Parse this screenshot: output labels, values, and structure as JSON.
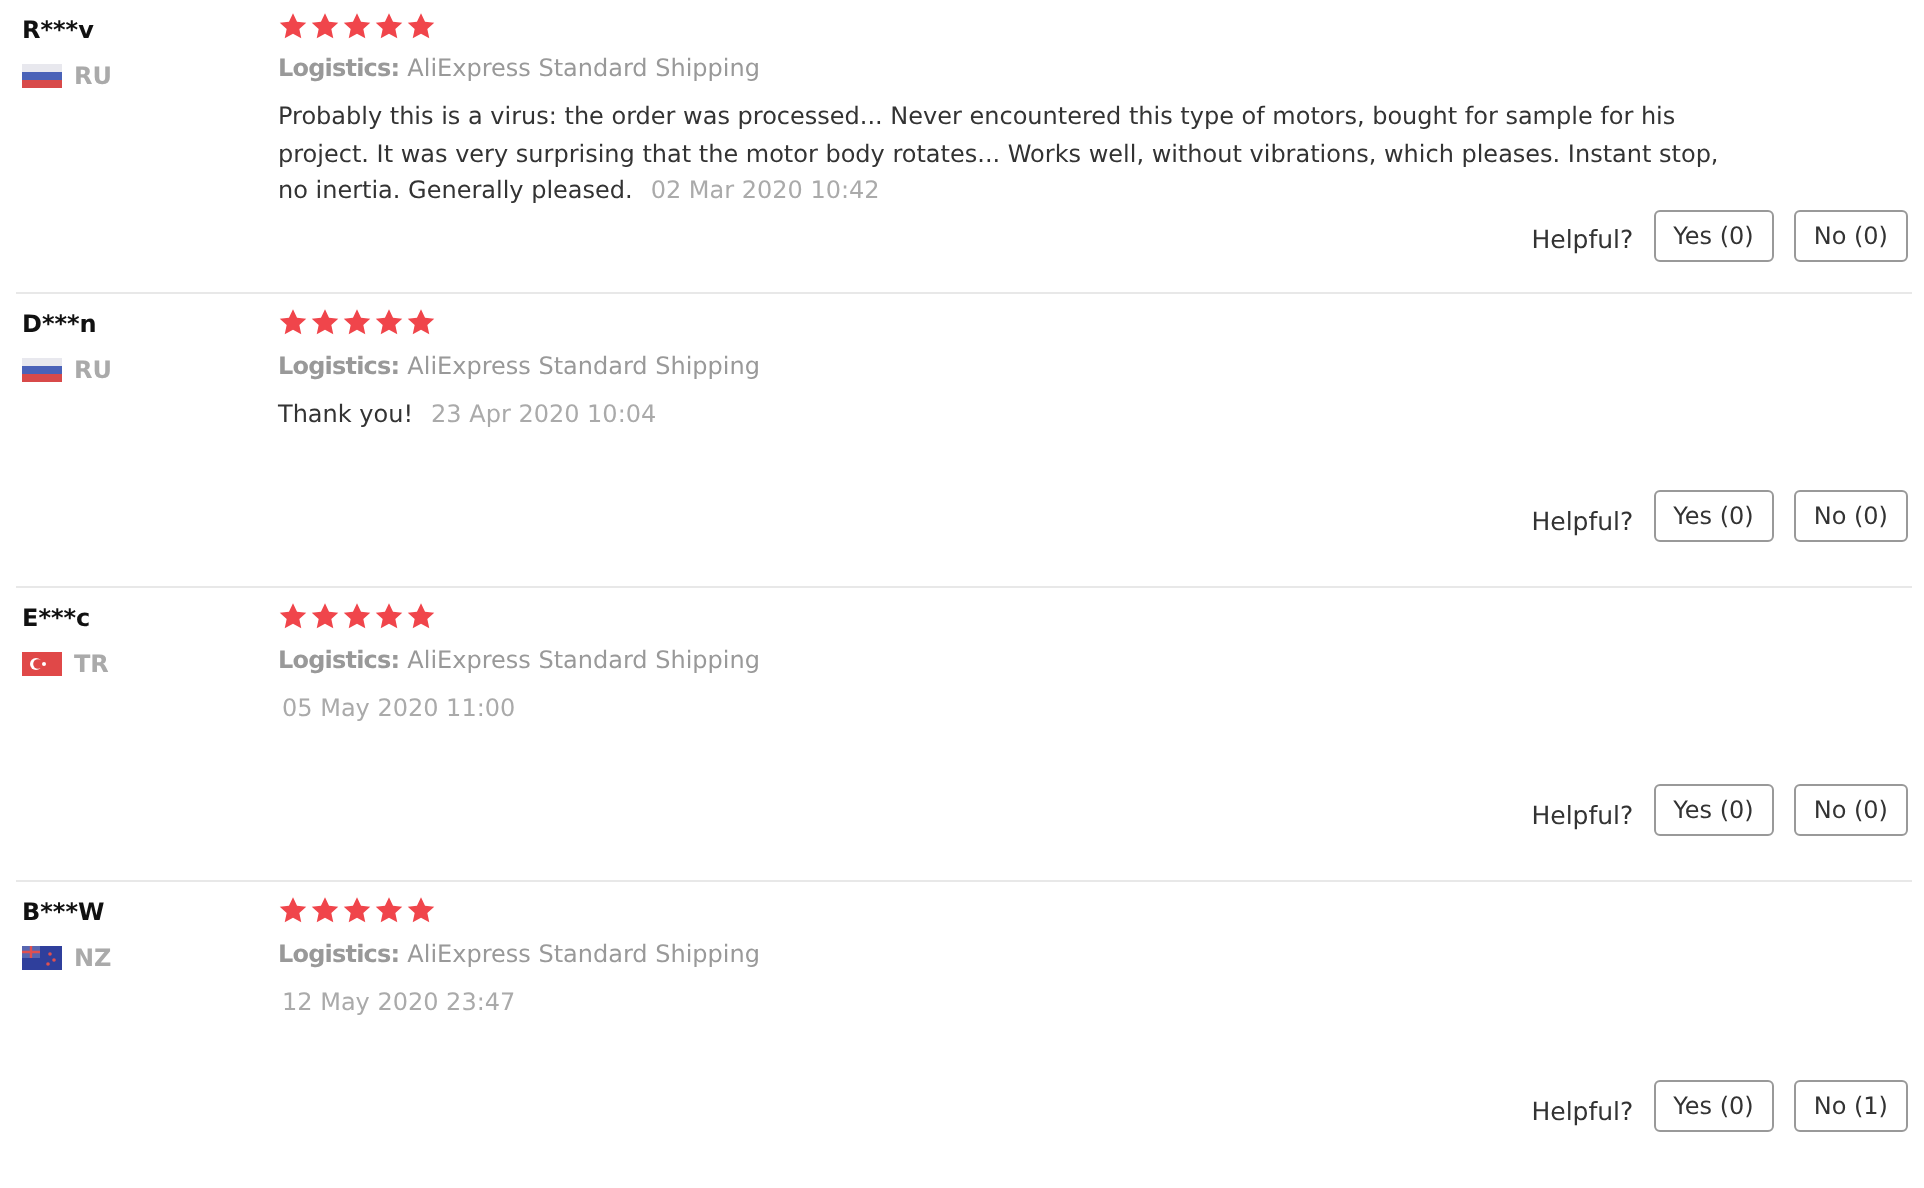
{
  "reviews": [
    {
      "name": "R***v",
      "kind": "ru",
      "country": "RU",
      "stars": 5,
      "logistics_label": "Logistics:",
      "logistics": "AliExpress Standard Shipping",
      "comment": "Probably this is a virus: the order was processed... Never encountered this type of motors, bought for sample for his project. It was very surprising that the motor body rotates... Works well, without vibrations, which pleases. Instant stop, no inertia. Generally pleased.",
      "date": "02 Mar 2020 10:42",
      "helpful_label": "Helpful?",
      "yes": "Yes (0)",
      "no": "No (0)"
    },
    {
      "name": "D***n",
      "kind": "ru",
      "country": "RU",
      "stars": 5,
      "logistics_label": "Logistics:",
      "logistics": "AliExpress Standard Shipping",
      "comment": "Thank you!",
      "date": "23 Apr 2020 10:04",
      "helpful_label": "Helpful?",
      "yes": "Yes (0)",
      "no": "No (0)"
    },
    {
      "name": "E***c",
      "kind": "tr",
      "country": "TR",
      "stars": 5,
      "logistics_label": "Logistics:",
      "logistics": "AliExpress Standard Shipping",
      "date": "05 May 2020 11:00",
      "helpful_label": "Helpful?",
      "yes": "Yes (0)",
      "no": "No (0)"
    },
    {
      "name": "B***W",
      "kind": "nz",
      "country": "NZ",
      "stars": 5,
      "logistics_label": "Logistics:",
      "logistics": "AliExpress Standard Shipping",
      "date": "12 May 2020 23:47",
      "helpful_label": "Helpful?",
      "yes": "Yes (0)",
      "no": "No (1)"
    }
  ]
}
